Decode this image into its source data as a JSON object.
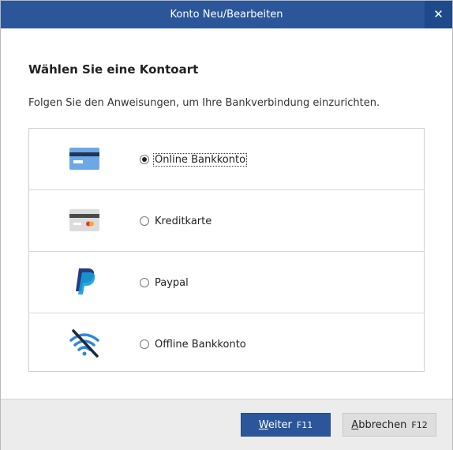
{
  "window": {
    "title": "Konto Neu/Bearbeiten",
    "close_glyph": "✕"
  },
  "main": {
    "heading": "Wählen Sie eine Kontoart",
    "instruction": "Folgen Sie den Anweisungen, um Ihre Bankverbindung einzurichten."
  },
  "options": [
    {
      "label": "Online Bankkonto",
      "icon": "bank-card-icon",
      "selected": true
    },
    {
      "label": "Kreditkarte",
      "icon": "credit-card-icon",
      "selected": false
    },
    {
      "label": "Paypal",
      "icon": "paypal-icon",
      "selected": false
    },
    {
      "label": "Offline Bankkonto",
      "icon": "wifi-off-icon",
      "selected": false
    }
  ],
  "footer": {
    "next_underline": "W",
    "next_rest": "eiter",
    "next_key": "F11",
    "cancel_underline": "A",
    "cancel_rest": "bbrechen",
    "cancel_key": "F12"
  },
  "colors": {
    "titlebar": "#2b579a",
    "primary_button": "#2b579a",
    "paypal_dark": "#253b80",
    "paypal_light": "#179bd7",
    "wifi_blue": "#2f88d8"
  }
}
